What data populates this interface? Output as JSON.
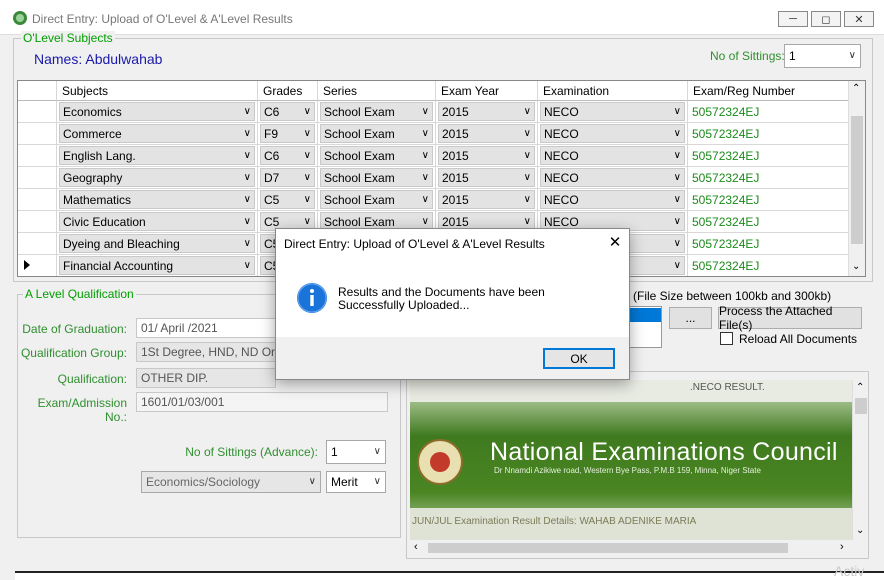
{
  "window": {
    "title": "Direct Entry: Upload of O'Level & A'Level Results",
    "minimize_icon": "minimize-icon",
    "maximize_icon": "maximize-icon",
    "close_icon": "close-icon"
  },
  "olevel": {
    "group_label": "O'Level Subjects",
    "names_label": "Names:",
    "name_value": "Abdulwahab",
    "sittings_label": "No of Sittings:",
    "sittings_value": "1",
    "columns": [
      "Subjects",
      "Grades",
      "Series",
      "Exam Year",
      "Examination",
      "Exam/Reg Number"
    ],
    "rows": [
      {
        "subject": "Economics",
        "grade": "C6",
        "series": "School Exam",
        "year": "2015",
        "exam": "NECO",
        "reg": "50572324EJ"
      },
      {
        "subject": "Commerce",
        "grade": "F9",
        "series": "School Exam",
        "year": "2015",
        "exam": "NECO",
        "reg": "50572324EJ"
      },
      {
        "subject": "English Lang.",
        "grade": "C6",
        "series": "School Exam",
        "year": "2015",
        "exam": "NECO",
        "reg": "50572324EJ"
      },
      {
        "subject": "Geography",
        "grade": "D7",
        "series": "School Exam",
        "year": "2015",
        "exam": "NECO",
        "reg": "50572324EJ"
      },
      {
        "subject": "Mathematics",
        "grade": "C5",
        "series": "School Exam",
        "year": "2015",
        "exam": "NECO",
        "reg": "50572324EJ"
      },
      {
        "subject": "Civic Education",
        "grade": "C5",
        "series": "School Exam",
        "year": "2015",
        "exam": "NECO",
        "reg": "50572324EJ"
      },
      {
        "subject": "Dyeing and Bleaching",
        "grade": "C5",
        "series": "",
        "year": "",
        "exam": "",
        "reg": "50572324EJ"
      },
      {
        "subject": "Financial Accounting",
        "grade": "C5",
        "series": "",
        "year": "",
        "exam": "",
        "reg": "50572324EJ"
      }
    ]
  },
  "alevel": {
    "group_label": "A Level Qualification",
    "graduation_label": "Date of Graduation:",
    "graduation_value": "01/     April     /2021",
    "qual_group_label": "Qualification Group:",
    "qual_group_value": "1St Degree, HND, ND Or Eq",
    "qualification_label": "Qualification:",
    "qualification_value": "OTHER DIP.",
    "exam_no_label": "Exam/Admission No.:",
    "exam_no_value": "1601/01/03/001",
    "sittings_adv_label": "No of Sittings (Advance):",
    "sittings_adv_value": "1",
    "course_value": "Economics/Sociology",
    "grade_value": "Merit"
  },
  "upload": {
    "file_size_note": "(File Size between 100kb and 300kb)",
    "browse_label": "...",
    "process_label": "Process the Attached File(s)",
    "reload_label": "Reload All Documents",
    "reload_checked": false,
    "doc_header": ".NECO RESULT.",
    "doc_title": "National Examinations Council",
    "doc_address": "Dr Nnamdi Azikiwe road, Western Bye Pass, P.M.B 159, Minna, Niger State",
    "doc_details": "JUN/JUL Examination Result Details: WAHAB ADENIKE MARIA"
  },
  "dialog": {
    "title": "Direct Entry: Upload of O'Level & A'Level Results",
    "message": "Results and the Documents have been Successfully Uploaded...",
    "ok_label": "OK",
    "info_icon": "info-icon"
  },
  "watermark": "Activ"
}
